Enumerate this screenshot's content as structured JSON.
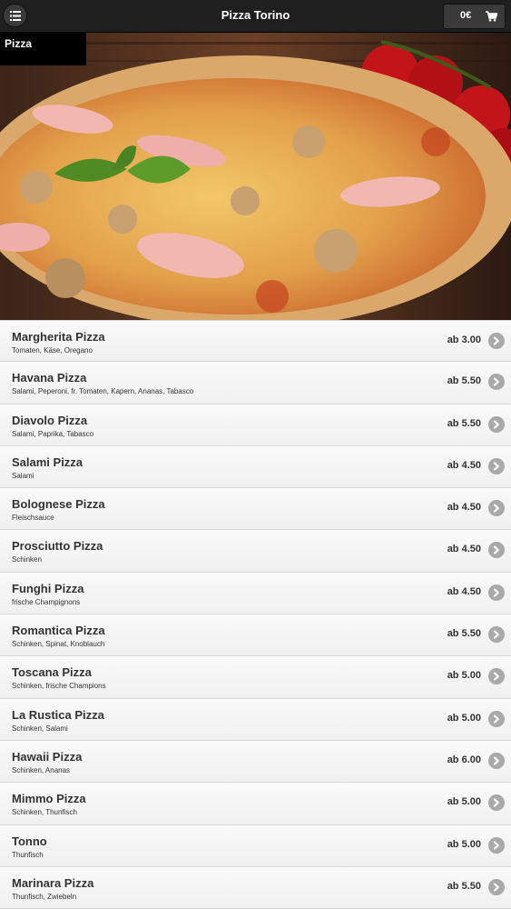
{
  "header": {
    "title": "Pizza Torino",
    "cart_total": "0€",
    "menu_icon": "list-icon",
    "cart_icon": "cart-icon"
  },
  "category": {
    "title": "Pizza"
  },
  "items": [
    {
      "name": "Margherita Pizza",
      "description": "Tomaten, Käse, Oregano",
      "price": "ab 3.00"
    },
    {
      "name": "Havana Pizza",
      "description": "Salami, Peperoni, fr. Tomaten, Kapern, Ananas, Tabasco",
      "price": "ab 5.50"
    },
    {
      "name": "Diavolo Pizza",
      "description": "Salami, Paprika, Tabasco",
      "price": "ab 5.50"
    },
    {
      "name": "Salami Pizza",
      "description": "Salami",
      "price": "ab 4.50"
    },
    {
      "name": "Bolognese Pizza",
      "description": "Fleischsauce",
      "price": "ab 4.50"
    },
    {
      "name": "Prosciutto Pizza",
      "description": "Schinken",
      "price": "ab 4.50"
    },
    {
      "name": "Funghi Pizza",
      "description": "frische Champignons",
      "price": "ab 4.50"
    },
    {
      "name": "Romantica Pizza",
      "description": "Schinken, Spinat, Knoblauch",
      "price": "ab 5.50"
    },
    {
      "name": "Toscana Pizza",
      "description": "Schinken, frische Champions",
      "price": "ab 5.00"
    },
    {
      "name": "La Rustica Pizza",
      "description": "Schinken, Salami",
      "price": "ab 5.00"
    },
    {
      "name": "Hawaii Pizza",
      "description": "Schinken, Ananas",
      "price": "ab 6.00"
    },
    {
      "name": "Mimmo Pizza",
      "description": "Schinken, Thunfisch",
      "price": "ab 5.00"
    },
    {
      "name": "Tonno",
      "description": "Thunfisch",
      "price": "ab 5.00"
    },
    {
      "name": "Marinara Pizza",
      "description": "Thunfisch, Zwiebeln",
      "price": "ab 5.50"
    }
  ],
  "colors": {
    "header_bg": "#1f1f1f",
    "arrow_bg": "#a9a9a9",
    "text": "#333333"
  }
}
